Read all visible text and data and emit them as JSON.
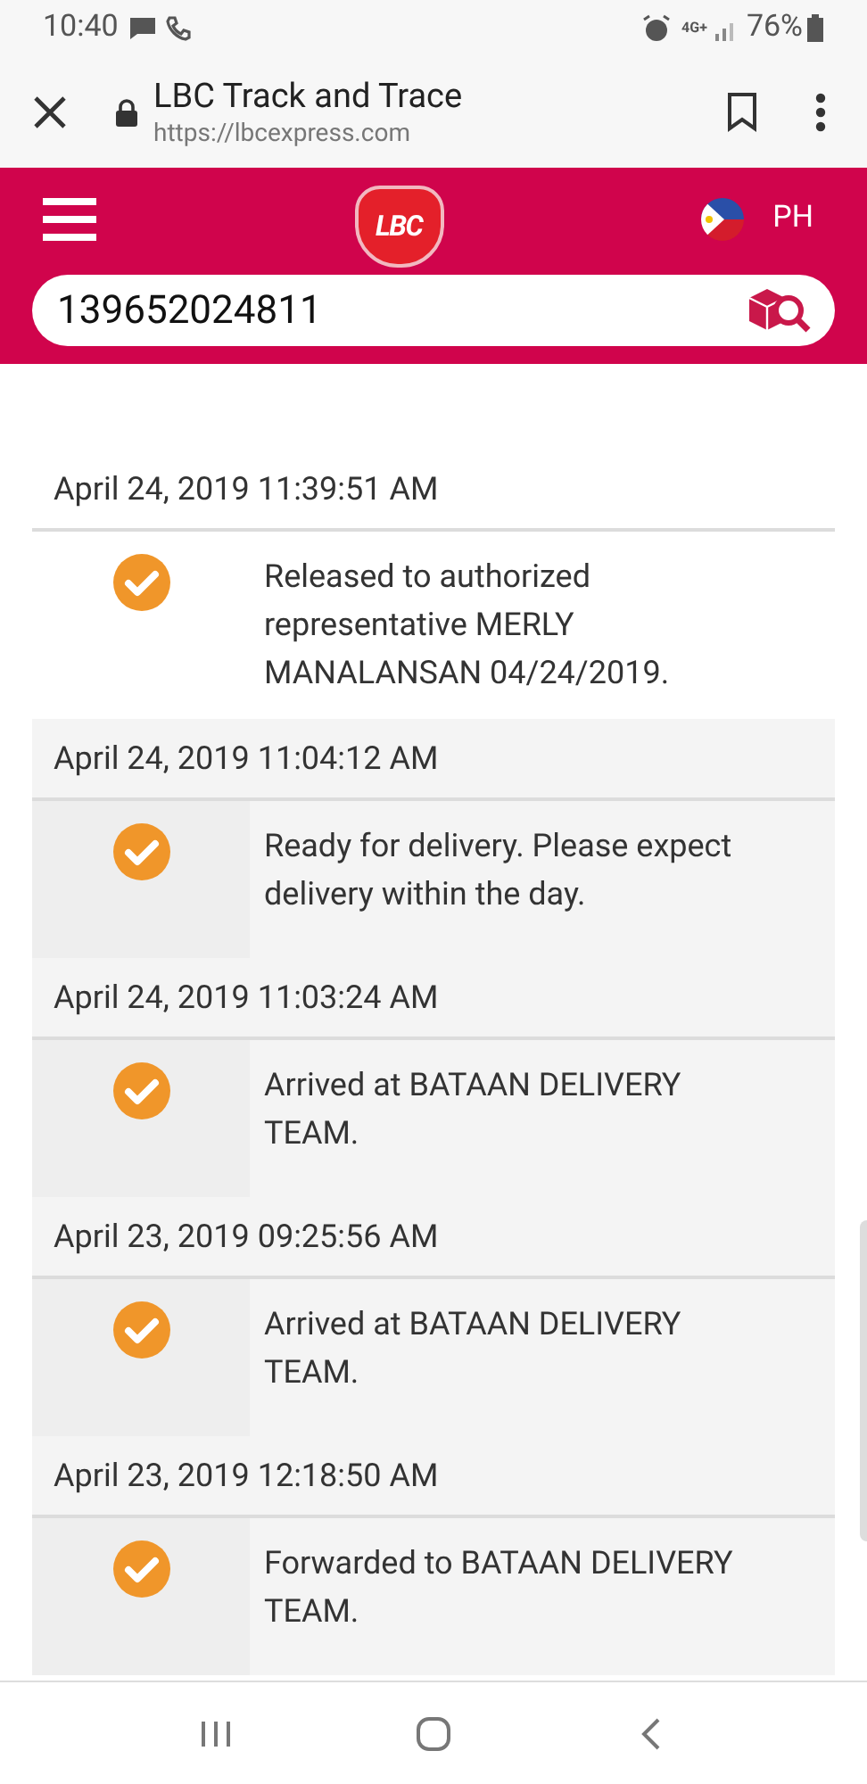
{
  "status_bar": {
    "time": "10:40",
    "network": "4G+",
    "battery": "76%"
  },
  "browser": {
    "title": "LBC Track and Trace",
    "url": "https://lbcexpress.com"
  },
  "header": {
    "logo": "LBC",
    "country": "PH"
  },
  "search": {
    "value": "139652024811"
  },
  "events": [
    {
      "datetime": "April 24, 2019 11:39:51 AM",
      "status": "Released to authorized representative MERLY MANALANSAN 04/24/2019.",
      "shaded": false
    },
    {
      "datetime": "April 24, 2019 11:04:12 AM",
      "status": "Ready for delivery. Please expect delivery within the day.",
      "shaded": true
    },
    {
      "datetime": "April 24, 2019 11:03:24 AM",
      "status": "Arrived at BATAAN DELIVERY TEAM.",
      "shaded": true
    },
    {
      "datetime": "April 23, 2019 09:25:56 AM",
      "status": "Arrived at BATAAN DELIVERY TEAM.",
      "shaded": true
    },
    {
      "datetime": "April 23, 2019 12:18:50 AM",
      "status": "Forwarded to BATAAN DELIVERY TEAM.",
      "shaded": true
    }
  ]
}
